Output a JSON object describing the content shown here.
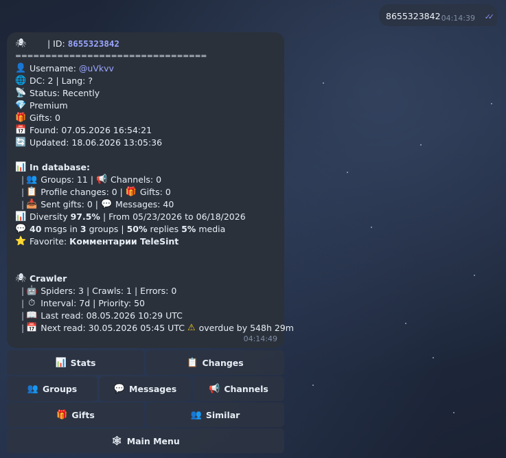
{
  "outgoing": {
    "text": "8655323842",
    "time": "04:14:39",
    "ticks": "✓✓"
  },
  "incoming": {
    "header_icon": "spider-icon",
    "id_label": "| ID:",
    "id_value": "8655323842",
    "separator": "================================",
    "username_label": "Username:",
    "username_value": "@uVkvv",
    "dc": "DC: 2 | Lang: ?",
    "status": "Status: Recently",
    "premium": "Premium",
    "gifts": "Gifts: 0",
    "found": "Found: 07.05.2026 16:54:21",
    "updated": "Updated: 18.06.2026 13:05:36",
    "db_title": "In database:",
    "groups": "Groups: 11 |",
    "channels": "Channels: 0",
    "profile_changes": "Profile changes: 0 |",
    "db_gifts": "Gifts: 0",
    "sent_gifts": "Sent gifts: 0 |",
    "messages": "Messages: 40",
    "diversity_label": "Diversity",
    "diversity_value": "97.5%",
    "diversity_range": "| From 05/23/2026 to 06/18/2026",
    "msgs_count": "40",
    "msgs_text1": "msgs in",
    "msgs_groups": "3",
    "msgs_text2": "groups |",
    "replies_pct": "50%",
    "replies_text": "replies",
    "media_pct": "5%",
    "media_text": "media",
    "favorite_label": "Favorite:",
    "favorite_value": "Комментарии TeleSint",
    "crawler_title": "Crawler",
    "spiders": "Spiders: 3 | Crawls: 1 | Errors: 0",
    "interval": "Interval: 7d | Priority: 50",
    "last_read": "Last read: 08.05.2026 10:29 UTC",
    "next_read": "Next read: 30.05.2026 05:45 UTC",
    "overdue": "overdue by 548h 29m",
    "time": "04:14:49"
  },
  "keyboard": {
    "stats": "Stats",
    "changes": "Changes",
    "groups": "Groups",
    "messages": "Messages",
    "channels": "Channels",
    "gifts": "Gifts",
    "similar": "Similar",
    "main_menu": "Main Menu"
  }
}
